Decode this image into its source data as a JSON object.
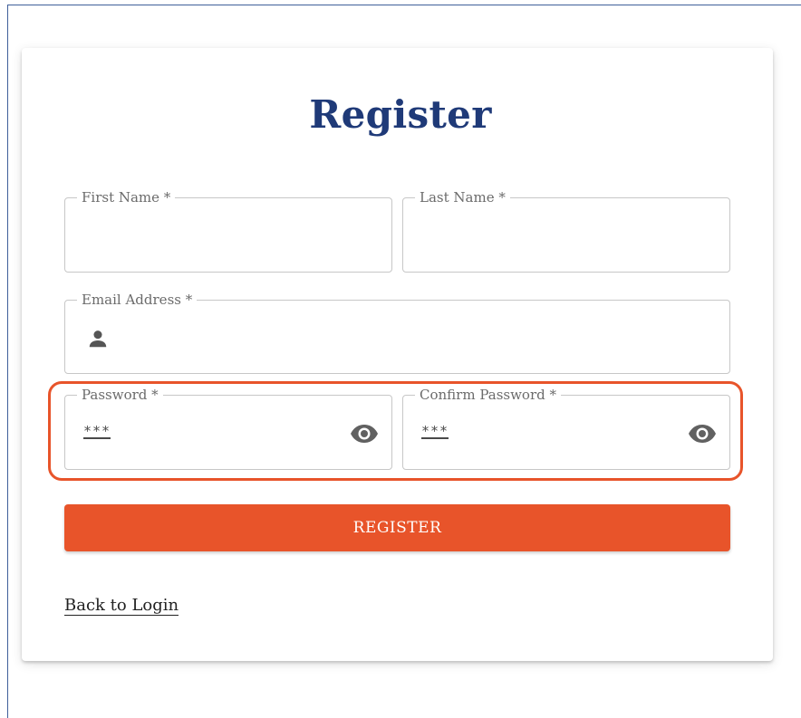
{
  "form": {
    "title": "Register",
    "first_name": {
      "label": "First Name *",
      "value": ""
    },
    "last_name": {
      "label": "Last Name *",
      "value": ""
    },
    "email": {
      "label": "Email Address *",
      "value": "",
      "icon": "person-icon"
    },
    "password": {
      "label": "Password *",
      "value": "***",
      "icon": "eye-icon"
    },
    "confirm_password": {
      "label": "Confirm Password *",
      "value": "***",
      "icon": "eye-icon"
    },
    "submit_label": "REGISTER",
    "back_link": "Back to Login"
  },
  "colors": {
    "title": "#1f3a78",
    "accent": "#e8542a",
    "highlight": "#e8542a"
  }
}
